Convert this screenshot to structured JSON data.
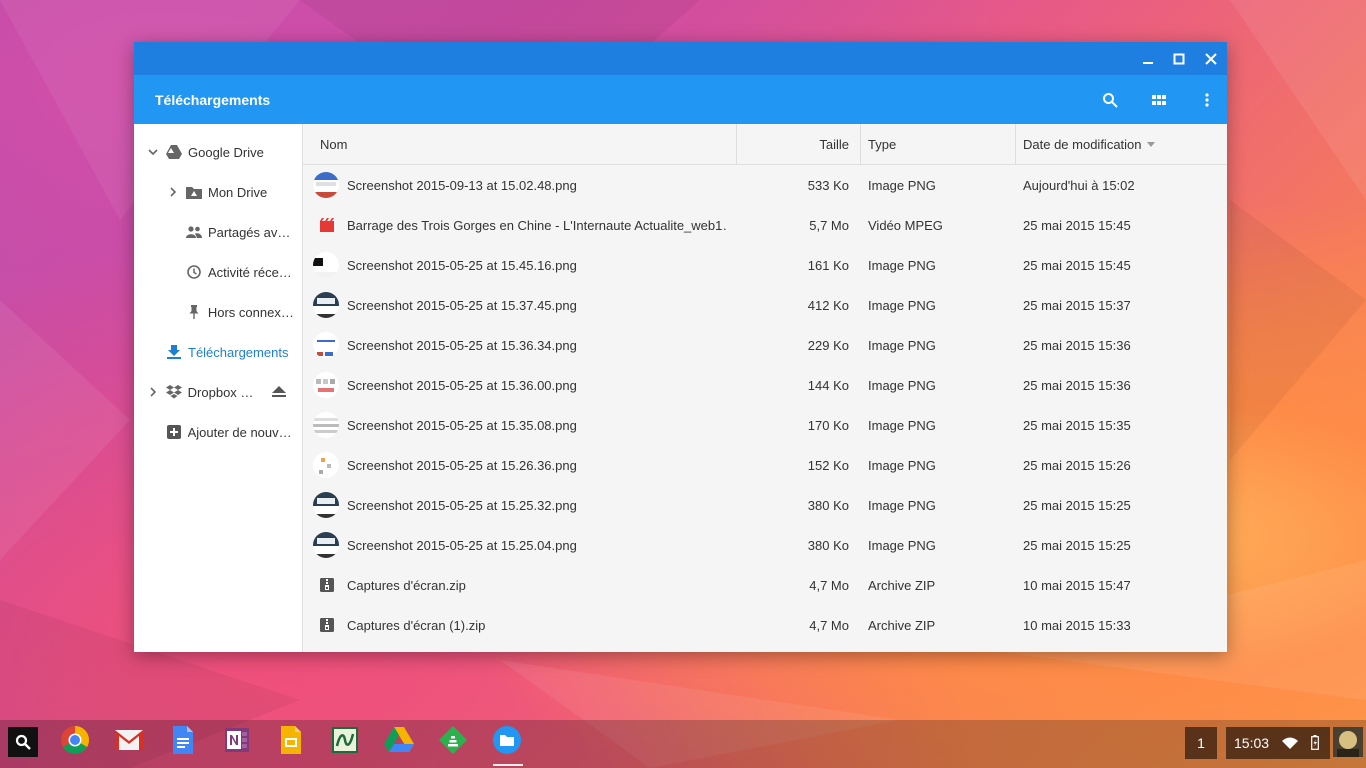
{
  "window": {
    "title": "Téléchargements"
  },
  "sidebar": {
    "items": [
      {
        "label": "Google Drive",
        "icon": "drive-icon"
      },
      {
        "label": "Mon Drive",
        "icon": "my-drive-icon"
      },
      {
        "label": "Partagés ave…",
        "icon": "shared-icon"
      },
      {
        "label": "Activité réce…",
        "icon": "clock-icon"
      },
      {
        "label": "Hors connexi…",
        "icon": "pin-icon"
      },
      {
        "label": "Téléchargements",
        "icon": "download-icon"
      },
      {
        "label": "Dropbox (…",
        "icon": "dropbox-icon"
      },
      {
        "label": "Ajouter de nouve…",
        "icon": "add-icon"
      }
    ]
  },
  "columns": {
    "name": "Nom",
    "size": "Taille",
    "type": "Type",
    "date": "Date de modification"
  },
  "files": [
    {
      "name": "Screenshot 2015-09-13 at 15.02.48.png",
      "size": "533 Ko",
      "type": "Image PNG",
      "date": "Aujourd'hui à 15:02",
      "kind": "image"
    },
    {
      "name": "Barrage des Trois Gorges en Chine - L'Internaute Actualite_web1…",
      "size": "5,7 Mo",
      "type": "Vidéo MPEG",
      "date": "25 mai 2015 15:45",
      "kind": "video"
    },
    {
      "name": "Screenshot 2015-05-25 at 15.45.16.png",
      "size": "161 Ko",
      "type": "Image PNG",
      "date": "25 mai 2015 15:45",
      "kind": "image"
    },
    {
      "name": "Screenshot 2015-05-25 at 15.37.45.png",
      "size": "412 Ko",
      "type": "Image PNG",
      "date": "25 mai 2015 15:37",
      "kind": "image"
    },
    {
      "name": "Screenshot 2015-05-25 at 15.36.34.png",
      "size": "229 Ko",
      "type": "Image PNG",
      "date": "25 mai 2015 15:36",
      "kind": "image"
    },
    {
      "name": "Screenshot 2015-05-25 at 15.36.00.png",
      "size": "144 Ko",
      "type": "Image PNG",
      "date": "25 mai 2015 15:36",
      "kind": "image"
    },
    {
      "name": "Screenshot 2015-05-25 at 15.35.08.png",
      "size": "170 Ko",
      "type": "Image PNG",
      "date": "25 mai 2015 15:35",
      "kind": "image"
    },
    {
      "name": "Screenshot 2015-05-25 at 15.26.36.png",
      "size": "152 Ko",
      "type": "Image PNG",
      "date": "25 mai 2015 15:26",
      "kind": "image"
    },
    {
      "name": "Screenshot 2015-05-25 at 15.25.32.png",
      "size": "380 Ko",
      "type": "Image PNG",
      "date": "25 mai 2015 15:25",
      "kind": "image"
    },
    {
      "name": "Screenshot 2015-05-25 at 15.25.04.png",
      "size": "380 Ko",
      "type": "Image PNG",
      "date": "25 mai 2015 15:25",
      "kind": "image"
    },
    {
      "name": "Captures d'écran.zip",
      "size": "4,7 Mo",
      "type": "Archive ZIP",
      "date": "10 mai 2015 15:47",
      "kind": "zip"
    },
    {
      "name": "Captures d'écran (1).zip",
      "size": "4,7 Mo",
      "type": "Archive ZIP",
      "date": "10 mai 2015 15:33",
      "kind": "zip"
    }
  ],
  "shelf": {
    "apps": [
      "chrome-icon",
      "gmail-icon",
      "docs-icon",
      "onenote-icon",
      "slides-icon",
      "spreadsheet-app-icon",
      "drive-app-icon",
      "feedly-icon",
      "files-app-icon"
    ],
    "workspace": "1",
    "clock": "15:03"
  },
  "colors": {
    "titlebar": "#1e7fe0",
    "toolbar": "#2196f3",
    "accent": "#1e7fd0"
  }
}
